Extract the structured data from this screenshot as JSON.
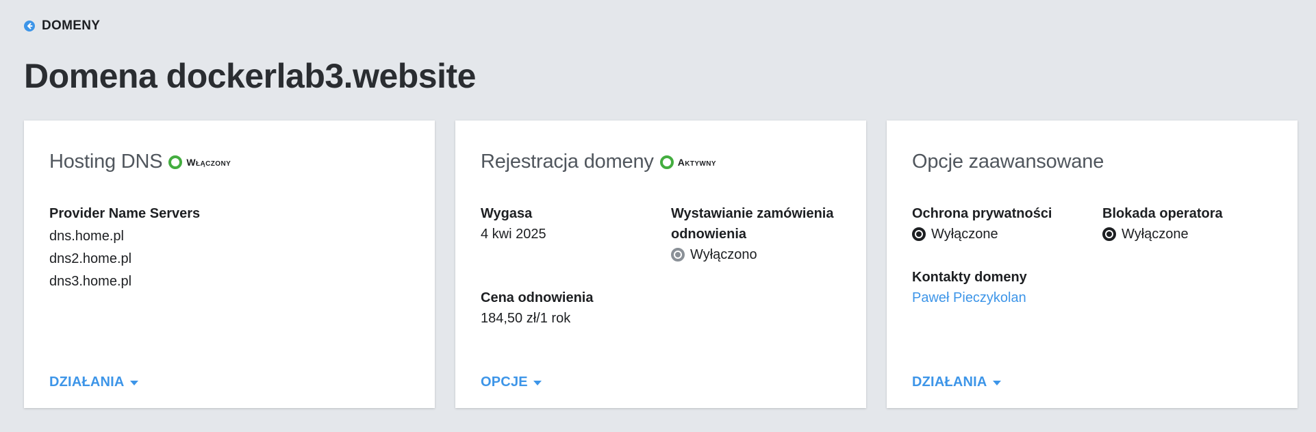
{
  "breadcrumb": {
    "back_label": "DOMENY"
  },
  "page": {
    "title": "Domena dockerlab3.website"
  },
  "cards": {
    "dns": {
      "title": "Hosting DNS",
      "status": "Włączony",
      "ns_label": "Provider Name Servers",
      "ns": [
        "dns.home.pl",
        "dns2.home.pl",
        "dns3.home.pl"
      ],
      "action": "DZIAŁANIA"
    },
    "registration": {
      "title": "Rejestracja domeny",
      "status": "Aktywny",
      "expires_label": "Wygasa",
      "expires_value": "4 kwi 2025",
      "renewal_order_label_1": "Wystawianie zamówienia",
      "renewal_order_label_2": "odnowienia",
      "renewal_order_value": "Wyłączono",
      "price_label": "Cena odnowienia",
      "price_value": "184,50 zł/1 rok",
      "action": "OPCJE"
    },
    "advanced": {
      "title": "Opcje zaawansowane",
      "privacy_label": "Ochrona prywatności",
      "privacy_value": "Wyłączone",
      "lock_label": "Blokada operatora",
      "lock_value": "Wyłączone",
      "contacts_label": "Kontakty domeny",
      "contact_name": "Paweł Pieczykolan",
      "action": "DZIAŁANIA"
    }
  },
  "colors": {
    "accent": "#3d95e8",
    "status_ok": "#43ad3f",
    "background": "#e4e7eb"
  }
}
